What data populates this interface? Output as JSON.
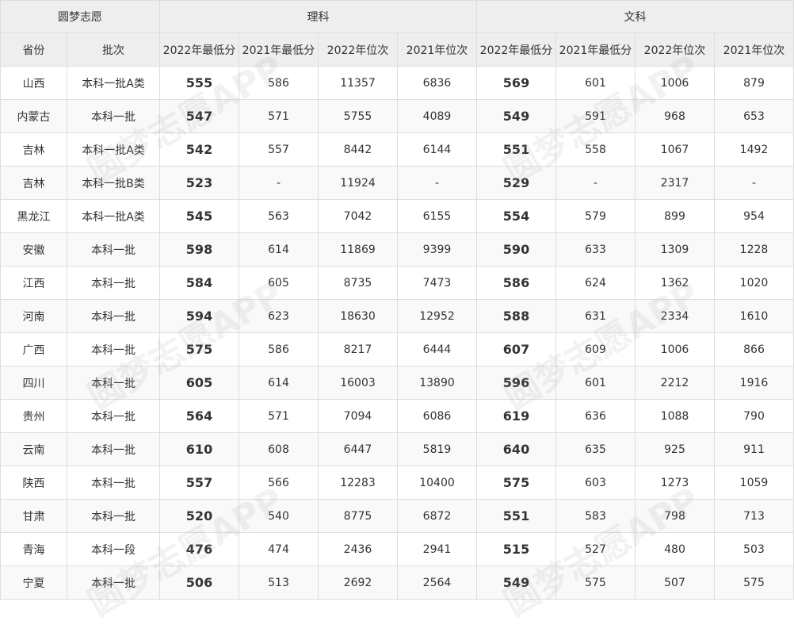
{
  "header": {
    "brand": "圆梦志愿",
    "science_group": "理科",
    "arts_group": "文科",
    "columns": [
      "省份",
      "批次",
      "2022年最低分",
      "2021年最低分",
      "2022年位次",
      "2021年位次",
      "2022年最低分",
      "2021年最低分",
      "2022年位次",
      "2021年位次"
    ]
  },
  "rows": [
    [
      "山西",
      "本科一批A类",
      "555",
      "586",
      "11357",
      "6836",
      "569",
      "601",
      "1006",
      "879"
    ],
    [
      "内蒙古",
      "本科一批",
      "547",
      "571",
      "5755",
      "4089",
      "549",
      "591",
      "968",
      "653"
    ],
    [
      "吉林",
      "本科一批A类",
      "542",
      "557",
      "8442",
      "6144",
      "551",
      "558",
      "1067",
      "1492"
    ],
    [
      "吉林",
      "本科一批B类",
      "523",
      "-",
      "11924",
      "-",
      "529",
      "-",
      "2317",
      "-"
    ],
    [
      "黑龙江",
      "本科一批A类",
      "545",
      "563",
      "7042",
      "6155",
      "554",
      "579",
      "899",
      "954"
    ],
    [
      "安徽",
      "本科一批",
      "598",
      "614",
      "11869",
      "9399",
      "590",
      "633",
      "1309",
      "1228"
    ],
    [
      "江西",
      "本科一批",
      "584",
      "605",
      "8735",
      "7473",
      "586",
      "624",
      "1362",
      "1020"
    ],
    [
      "河南",
      "本科一批",
      "594",
      "623",
      "18630",
      "12952",
      "588",
      "631",
      "2334",
      "1610"
    ],
    [
      "广西",
      "本科一批",
      "575",
      "586",
      "8217",
      "6444",
      "607",
      "609",
      "1006",
      "866"
    ],
    [
      "四川",
      "本科一批",
      "605",
      "614",
      "16003",
      "13890",
      "596",
      "601",
      "2212",
      "1916"
    ],
    [
      "贵州",
      "本科一批",
      "564",
      "571",
      "7094",
      "6086",
      "619",
      "636",
      "1088",
      "790"
    ],
    [
      "云南",
      "本科一批",
      "610",
      "608",
      "6447",
      "5819",
      "640",
      "635",
      "925",
      "911"
    ],
    [
      "陕西",
      "本科一批",
      "557",
      "566",
      "12283",
      "10400",
      "575",
      "603",
      "1273",
      "1059"
    ],
    [
      "甘肃",
      "本科一批",
      "520",
      "540",
      "8775",
      "6872",
      "551",
      "583",
      "798",
      "713"
    ],
    [
      "青海",
      "本科一段",
      "476",
      "474",
      "2436",
      "2941",
      "515",
      "527",
      "480",
      "503"
    ],
    [
      "宁夏",
      "本科一批",
      "506",
      "513",
      "2692",
      "2564",
      "549",
      "575",
      "507",
      "575"
    ]
  ],
  "watermark": "圆梦志愿APP"
}
